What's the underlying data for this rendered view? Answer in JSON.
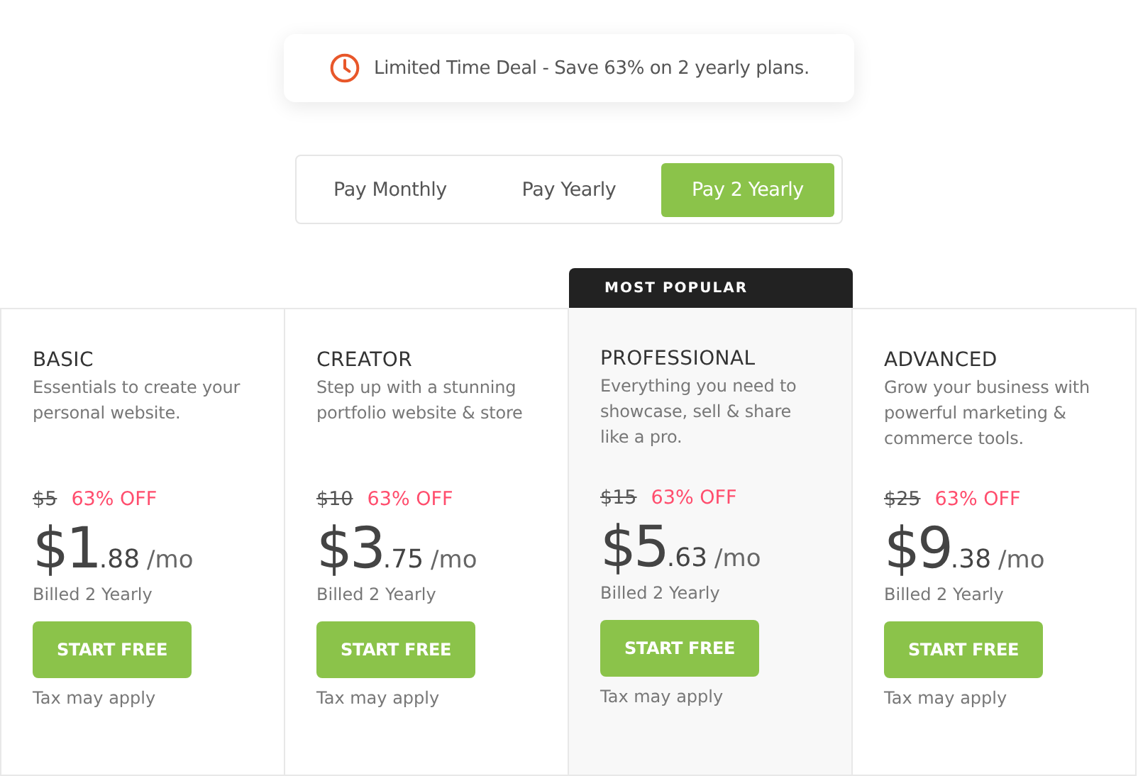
{
  "banner": {
    "text": "Limited Time Deal - Save 63% on 2 yearly plans."
  },
  "billing_tabs": [
    {
      "label": "Pay Monthly",
      "selected": false
    },
    {
      "label": "Pay Yearly",
      "selected": false
    },
    {
      "label": "Pay 2 Yearly",
      "selected": true
    }
  ],
  "plans": [
    {
      "name": "BASIC",
      "description": "Essentials to create your personal website.",
      "old_price": "$5",
      "discount": "63% OFF",
      "price_whole": "$1",
      "price_cents": ".88",
      "per": "/mo",
      "billing": "Billed 2 Yearly",
      "button": "START FREE",
      "note": "Tax may apply",
      "popular": false
    },
    {
      "name": "CREATOR",
      "description": "Step up with a stunning portfolio website & store",
      "old_price": "$10",
      "discount": "63% OFF",
      "price_whole": "$3",
      "price_cents": ".75",
      "per": "/mo",
      "billing": "Billed 2 Yearly",
      "button": "START FREE",
      "note": "Tax may apply",
      "popular": false
    },
    {
      "name": "PROFESSIONAL",
      "description": "Everything you need to showcase, sell & share like a pro.",
      "old_price": "$15",
      "discount": "63% OFF",
      "price_whole": "$5",
      "price_cents": ".63",
      "per": "/mo",
      "billing": "Billed 2 Yearly",
      "button": "START FREE",
      "note": "Tax may apply",
      "popular": true,
      "badge": "MOST POPULAR"
    },
    {
      "name": "ADVANCED",
      "description": "Grow your business with powerful marketing & commerce tools.",
      "old_price": "$25",
      "discount": "63% OFF",
      "price_whole": "$9",
      "price_cents": ".38",
      "per": "/mo",
      "billing": "Billed 2 Yearly",
      "button": "START FREE",
      "note": "Tax may apply",
      "popular": false
    }
  ]
}
